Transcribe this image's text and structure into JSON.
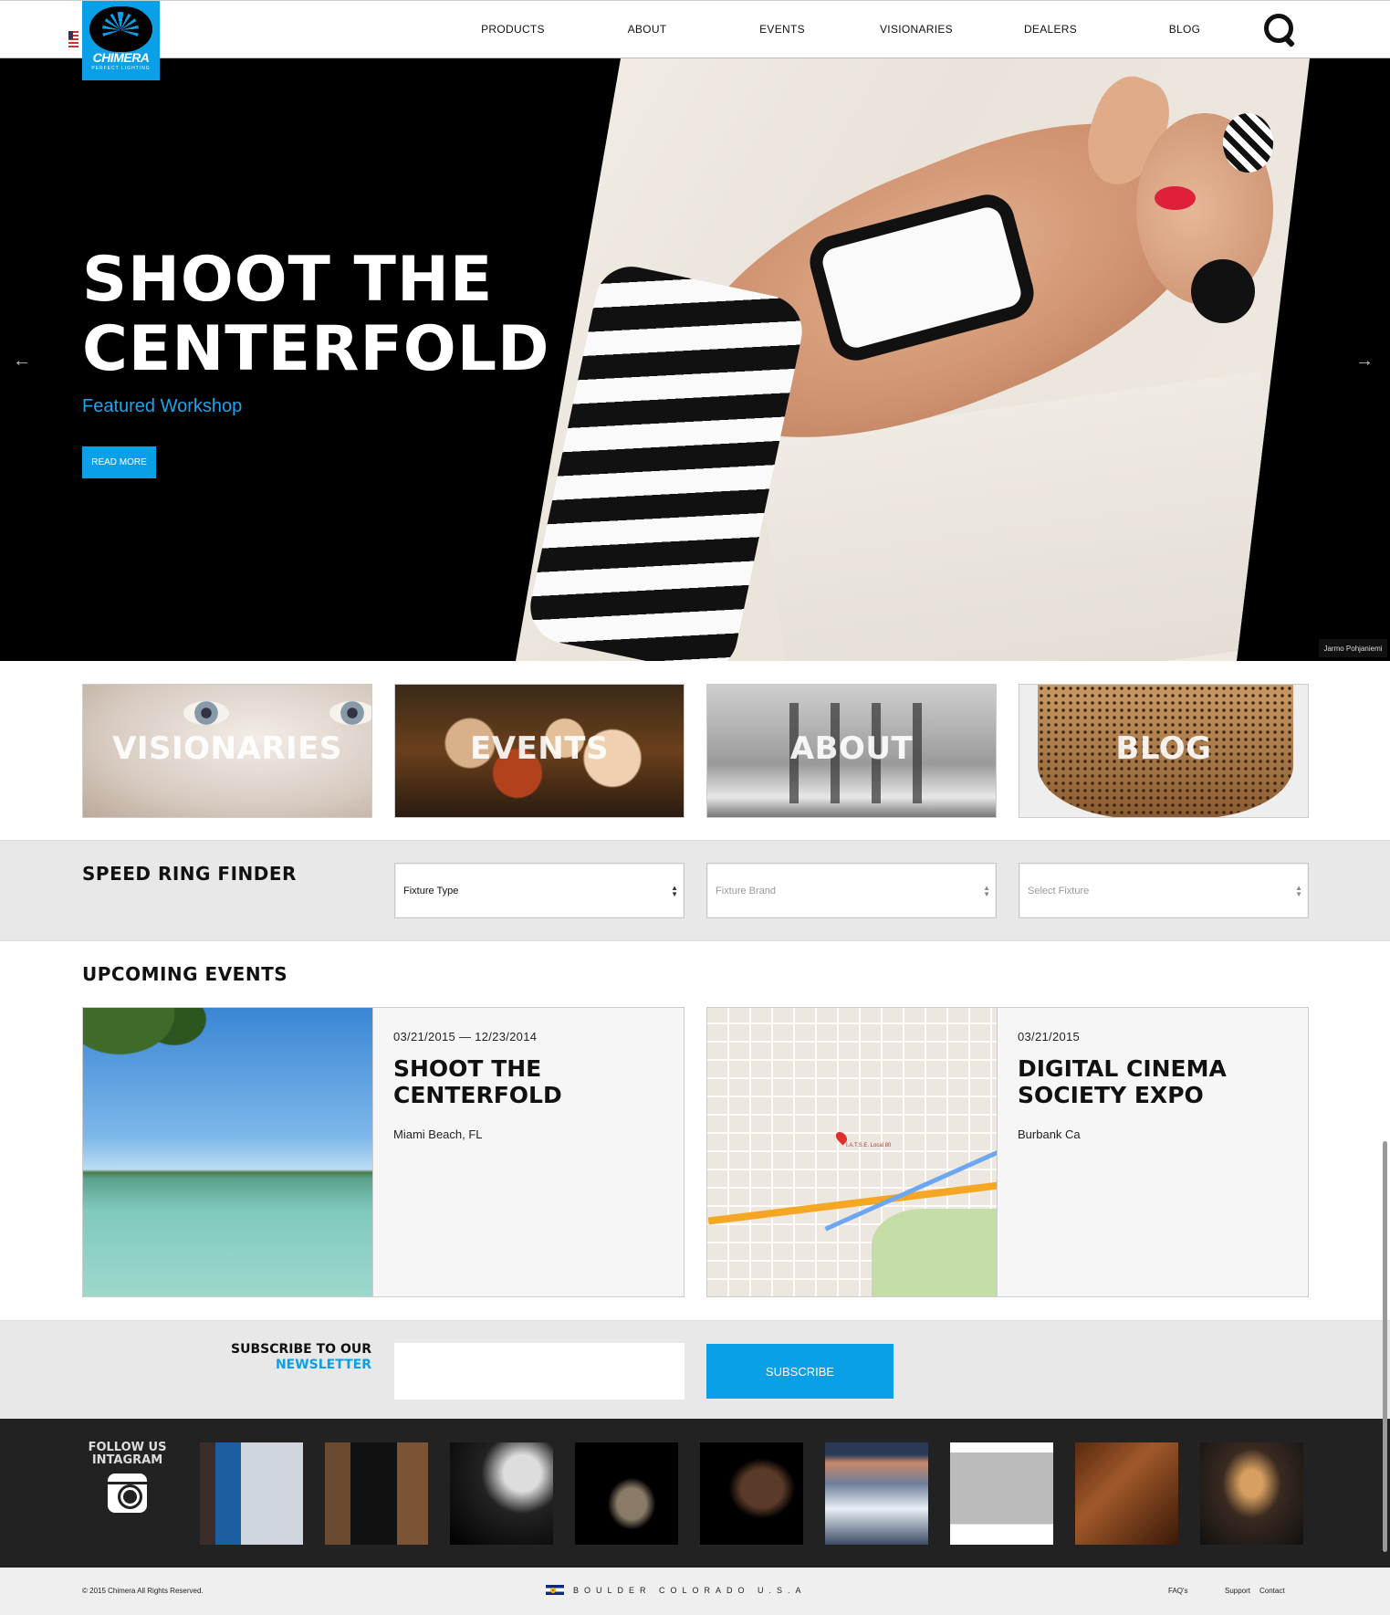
{
  "header": {
    "logo": {
      "name": "CHIMERA",
      "tagline": "PERFECT LIGHTING"
    },
    "nav": [
      {
        "label": "PRODUCTS"
      },
      {
        "label": "ABOUT"
      },
      {
        "label": "EVENTS"
      },
      {
        "label": "VISIONARIES"
      },
      {
        "label": "DEALERS"
      },
      {
        "label": "BLOG"
      }
    ],
    "search_icon": "search-icon",
    "flag_icon": "us-flag-icon"
  },
  "hero": {
    "title_line1": "SHOOT THE",
    "title_line2": "CENTERFOLD",
    "subtitle": "Featured Workshop",
    "button": "READ MORE",
    "prev": "←",
    "next": "→",
    "photo_credit": "Jarmo Pohjaniemi"
  },
  "tiles": [
    {
      "label": "VISIONARIES"
    },
    {
      "label": "EVENTS"
    },
    {
      "label": "ABOUT"
    },
    {
      "label": "BLOG"
    }
  ],
  "finder": {
    "title": "SPEED RING FINDER",
    "selects": [
      {
        "value": "Fixture Type",
        "disabled": false
      },
      {
        "value": "Fixture Brand",
        "disabled": true
      },
      {
        "value": "Select Fixture",
        "disabled": true
      }
    ]
  },
  "events": {
    "title": "UPCOMING EVENTS",
    "items": [
      {
        "date": "03/21/2015 — 12/23/2014",
        "name": "SHOOT THE CENTERFOLD",
        "location": "Miami Beach, FL"
      },
      {
        "date": "03/21/2015",
        "name": "DIGITAL CINEMA SOCIETY EXPO",
        "location": "Burbank Ca",
        "map_label": "I.A.T.S.E. Local 80"
      }
    ]
  },
  "newsletter": {
    "line1": "SUBSCRIBE TO OUR",
    "line2": "NEWSLETTER",
    "input_value": "",
    "button": "SUBSCRIBE"
  },
  "instagram": {
    "line1": "FOLLOW US",
    "line2": "INTAGRAM",
    "icon": "instagram-icon",
    "thumb_count": 9
  },
  "footer": {
    "copyright": "© 2015 Chimera All Rights Reserved.",
    "location": "BOULDER COLORADO U.S.A",
    "links": [
      {
        "label": "FAQ's"
      },
      {
        "label": "Support"
      },
      {
        "label": "Contact"
      }
    ]
  },
  "colors": {
    "accent": "#0aa0e8",
    "hero_bg": "#000000",
    "band_bg": "#e8e8e8",
    "insta_bg": "#222222"
  }
}
